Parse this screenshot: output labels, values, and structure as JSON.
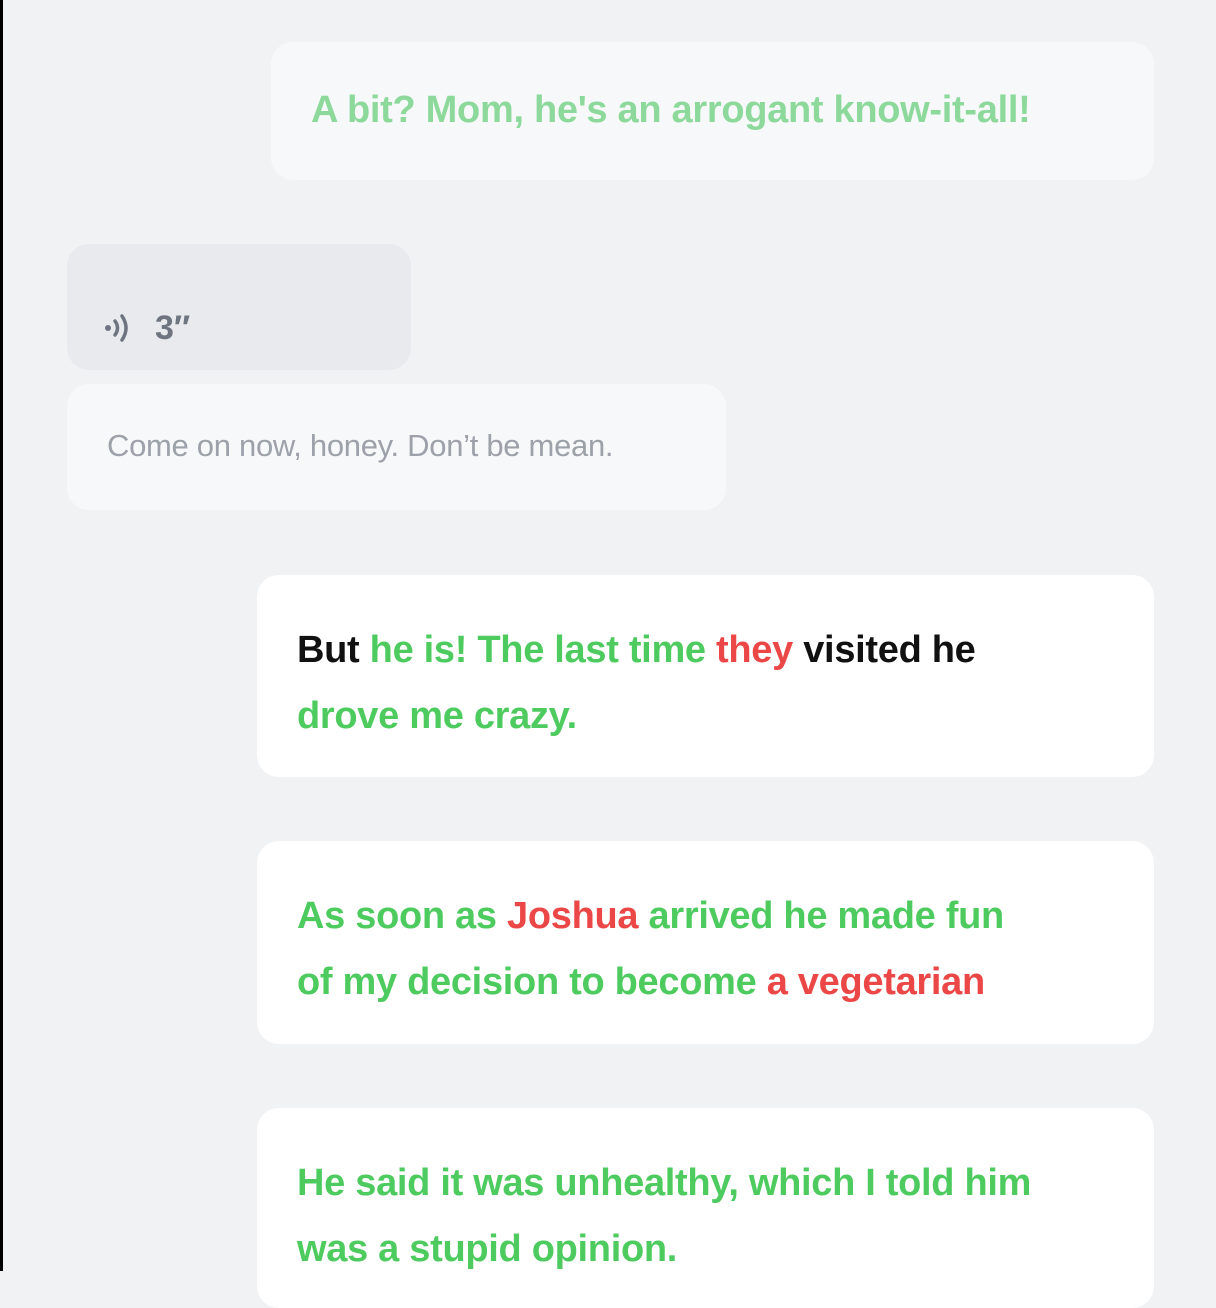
{
  "colors": {
    "background": "#f1f2f4",
    "green": "#4dcb5f",
    "pale_green": "#8cd99b",
    "red": "#ec4747",
    "black": "#111111",
    "gray_text": "#9ca1aa"
  },
  "messages": {
    "first": "A bit? Mom, he's an arrogant know-it-all!",
    "voice": {
      "icon": "sound-wave-icon",
      "duration": "3″"
    },
    "reply": "Come on now, honey. Don’t be mean.",
    "card1": {
      "line1": [
        "But ",
        "he is! The last time ",
        "they",
        " visited he"
      ],
      "line2": [
        "drove me crazy."
      ]
    },
    "card2": {
      "line1": [
        "As soon as ",
        "Joshua",
        " arrived he made fun"
      ],
      "line2": [
        "of my decision to become ",
        "a vegetarian"
      ]
    },
    "card3": {
      "line1": [
        "He said it was unhealthy, which I told him"
      ],
      "line2": [
        "was a stupid opinion."
      ]
    }
  }
}
